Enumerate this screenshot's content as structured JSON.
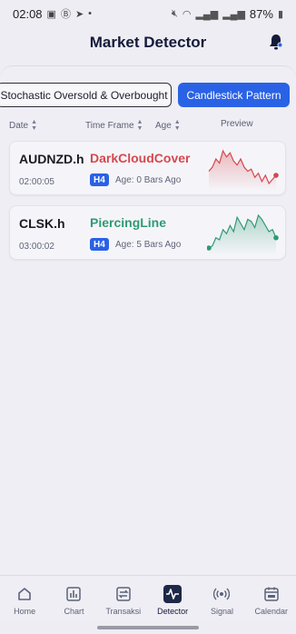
{
  "status_bar": {
    "time": "02:08",
    "battery": "87%"
  },
  "header": {
    "title": "Market Detector"
  },
  "tabs": [
    {
      "label": "Stochastic Oversold & Overbought",
      "active": false
    },
    {
      "label": "Candlestick Pattern",
      "active": true
    }
  ],
  "columns": {
    "date": "Date",
    "time_frame": "Time Frame",
    "age": "Age",
    "preview": "Preview"
  },
  "signals": [
    {
      "symbol": "AUDNZD.h",
      "time": "02:00:05",
      "pattern": "DarkCloudCover",
      "timeframe": "H4",
      "age": "Age: 0 Bars Ago",
      "trend": "bearish",
      "color": "#d5484f",
      "preview_values": [
        30,
        26,
        18,
        22,
        10,
        16,
        12,
        20,
        24,
        18,
        26,
        30,
        28,
        36,
        32,
        40,
        34,
        42,
        38,
        34
      ]
    },
    {
      "symbol": "CLSK.h",
      "time": "03:00:02",
      "pattern": "PiercingLine",
      "timeframe": "H4",
      "age": "Age: 5 Bars Ago",
      "trend": "bullish",
      "color": "#2f9a73",
      "preview_values": [
        40,
        38,
        30,
        32,
        22,
        26,
        18,
        24,
        10,
        16,
        22,
        12,
        14,
        20,
        8,
        12,
        18,
        24,
        22,
        30
      ]
    }
  ],
  "bottom_nav": [
    {
      "label": "Home",
      "icon": "home-icon",
      "active": false
    },
    {
      "label": "Chart",
      "icon": "bar-chart-icon",
      "active": false
    },
    {
      "label": "Transaksi",
      "icon": "transaction-icon",
      "active": false
    },
    {
      "label": "Detector",
      "icon": "pulse-icon",
      "active": true
    },
    {
      "label": "Signal",
      "icon": "signal-icon",
      "active": false
    },
    {
      "label": "Calendar",
      "icon": "calendar-icon",
      "active": false
    }
  ],
  "colors": {
    "accent": "#2a62e6",
    "bearish": "#d5484f",
    "bullish": "#2f9a73"
  }
}
